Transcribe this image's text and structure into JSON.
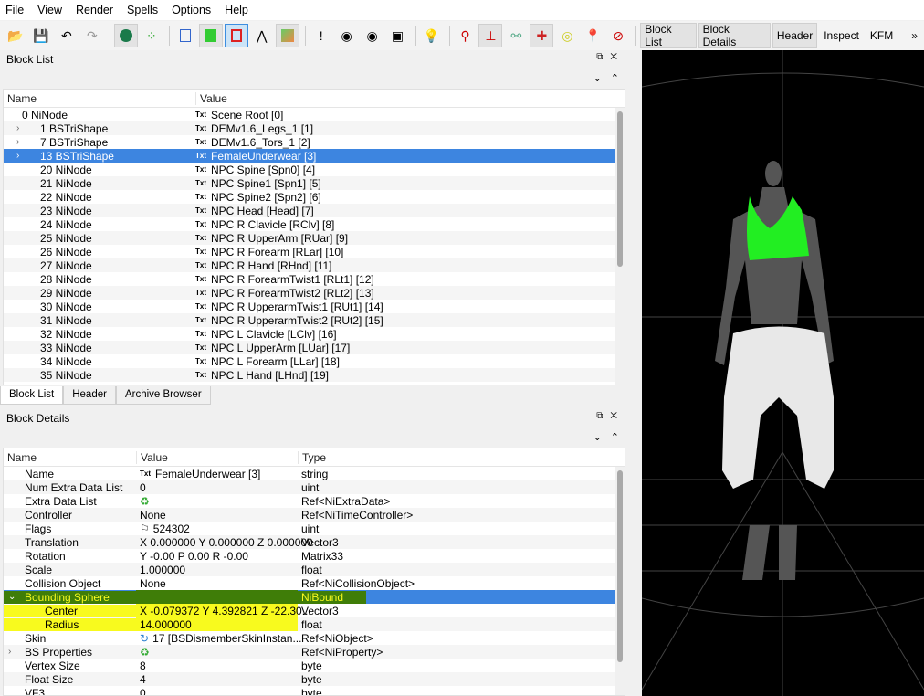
{
  "menu": [
    "File",
    "View",
    "Render",
    "Spells",
    "Options",
    "Help"
  ],
  "toolbar": {
    "buttons": [
      "Block List",
      "Block Details",
      "Header",
      "Inspect",
      "KFM"
    ],
    "more": "»"
  },
  "block_list": {
    "title": "Block List",
    "col_name": "Name",
    "col_value": "Value",
    "rows": [
      {
        "name": "0 NiNode",
        "value": "Scene Root [0]",
        "depth": 0,
        "exp": "open"
      },
      {
        "name": "1 BSTriShape",
        "value": "DEMv1.6_Legs_1 [1]",
        "depth": 1,
        "exp": "closed"
      },
      {
        "name": "7 BSTriShape",
        "value": "DEMv1.6_Tors_1 [2]",
        "depth": 1,
        "exp": "closed"
      },
      {
        "name": "13 BSTriShape",
        "value": "FemaleUnderwear [3]",
        "depth": 1,
        "exp": "closed",
        "selected": true
      },
      {
        "name": "20 NiNode",
        "value": "NPC Spine [Spn0] [4]",
        "depth": 1
      },
      {
        "name": "21 NiNode",
        "value": "NPC Spine1 [Spn1] [5]",
        "depth": 1
      },
      {
        "name": "22 NiNode",
        "value": "NPC Spine2 [Spn2] [6]",
        "depth": 1
      },
      {
        "name": "23 NiNode",
        "value": "NPC Head [Head] [7]",
        "depth": 1
      },
      {
        "name": "24 NiNode",
        "value": "NPC R Clavicle [RClv] [8]",
        "depth": 1
      },
      {
        "name": "25 NiNode",
        "value": "NPC R UpperArm [RUar] [9]",
        "depth": 1
      },
      {
        "name": "26 NiNode",
        "value": "NPC R Forearm [RLar] [10]",
        "depth": 1
      },
      {
        "name": "27 NiNode",
        "value": "NPC R Hand [RHnd] [11]",
        "depth": 1
      },
      {
        "name": "28 NiNode",
        "value": "NPC R ForearmTwist1 [RLt1] [12]",
        "depth": 1
      },
      {
        "name": "29 NiNode",
        "value": "NPC R ForearmTwist2 [RLt2] [13]",
        "depth": 1
      },
      {
        "name": "30 NiNode",
        "value": "NPC R UpperarmTwist1 [RUt1] [14]",
        "depth": 1
      },
      {
        "name": "31 NiNode",
        "value": "NPC R UpperarmTwist2 [RUt2] [15]",
        "depth": 1
      },
      {
        "name": "32 NiNode",
        "value": "NPC L Clavicle [LClv] [16]",
        "depth": 1
      },
      {
        "name": "33 NiNode",
        "value": "NPC L UpperArm [LUar] [17]",
        "depth": 1
      },
      {
        "name": "34 NiNode",
        "value": "NPC L Forearm [LLar] [18]",
        "depth": 1
      },
      {
        "name": "35 NiNode",
        "value": "NPC L Hand [LHnd] [19]",
        "depth": 1
      }
    ]
  },
  "tabs": [
    "Block List",
    "Header",
    "Archive Browser"
  ],
  "block_details": {
    "title": "Block Details",
    "col_name": "Name",
    "col_value": "Value",
    "col_type": "Type",
    "rows": [
      {
        "name": "Name",
        "value": "FemaleUnderwear [3]",
        "type": "string",
        "icon": "txt"
      },
      {
        "name": "Num Extra Data List",
        "value": "0",
        "type": "uint"
      },
      {
        "name": "Extra Data List",
        "value": "",
        "type": "Ref<NiExtraData>",
        "icon": "link"
      },
      {
        "name": "Controller",
        "value": "None",
        "type": "Ref<NiTimeController>"
      },
      {
        "name": "Flags",
        "value": "524302",
        "type": "uint",
        "icon": "flag"
      },
      {
        "name": "Translation",
        "value": "X 0.000000 Y 0.000000 Z 0.000000",
        "type": "Vector3"
      },
      {
        "name": "Rotation",
        "value": "Y -0.00 P 0.00 R -0.00",
        "type": "Matrix33"
      },
      {
        "name": "Scale",
        "value": "1.000000",
        "type": "float"
      },
      {
        "name": "Collision Object",
        "value": "None",
        "type": "Ref<NiCollisionObject>"
      },
      {
        "name": "Bounding Sphere",
        "value": "",
        "type": "NiBound",
        "exp": "open",
        "selected": true
      },
      {
        "name": "Center",
        "value": "X -0.079372 Y 4.392821 Z -22.30...",
        "type": "Vector3",
        "child": true,
        "hl": true
      },
      {
        "name": "Radius",
        "value": "14.000000",
        "type": "float",
        "child": true,
        "hl": true
      },
      {
        "name": "Skin",
        "value": "17 [BSDismemberSkinInstan...",
        "type": "Ref<NiObject>",
        "icon": "skin"
      },
      {
        "name": "BS Properties",
        "value": "",
        "type": "Ref<NiProperty>",
        "icon": "link",
        "exp": "closed"
      },
      {
        "name": "Vertex Size",
        "value": "8",
        "type": "byte"
      },
      {
        "name": "Float Size",
        "value": "4",
        "type": "byte"
      },
      {
        "name": "VF3",
        "value": "0",
        "type": "byte"
      }
    ]
  },
  "colors": {
    "selection": "#3d85e0",
    "highlight": "#f8fa1e",
    "mesh_green": "#22ee22"
  }
}
